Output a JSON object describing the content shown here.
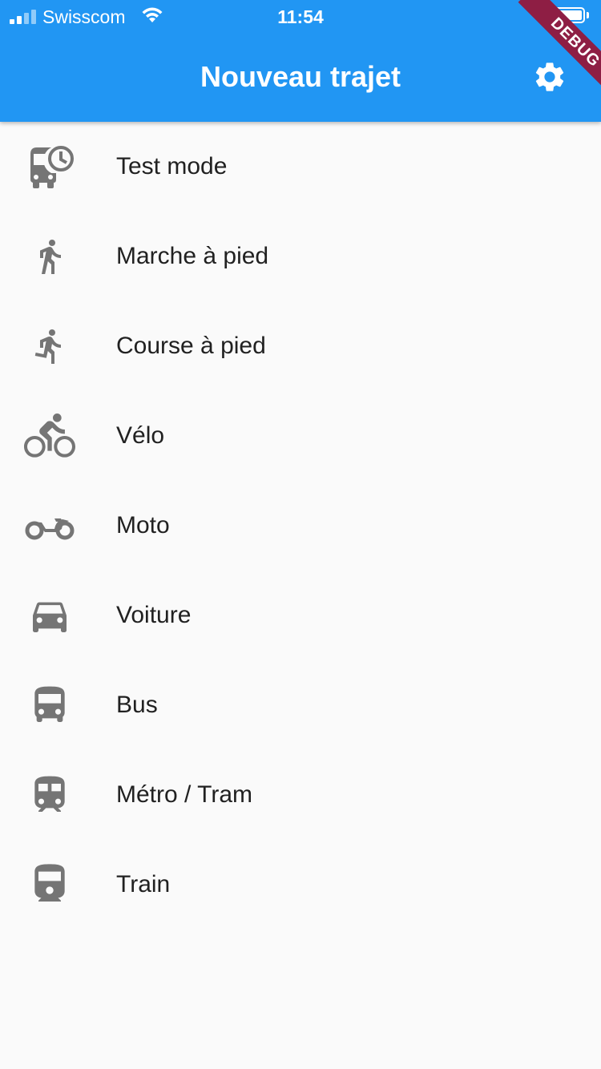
{
  "status_bar": {
    "carrier": "Swisscom",
    "time": "11:54"
  },
  "app_bar": {
    "title": "Nouveau trajet",
    "action_icon": "settings-icon",
    "debug_banner": "DEBUG"
  },
  "colors": {
    "app_bar": "#2196f3",
    "background": "#fafafa",
    "icon": "#757575",
    "text": "#212121",
    "debug_ribbon": "#8e1e44"
  },
  "modes": [
    {
      "label": "Test mode",
      "icon": "bus-clock-icon"
    },
    {
      "label": "Marche à pied",
      "icon": "walk-icon"
    },
    {
      "label": "Course à pied",
      "icon": "run-icon"
    },
    {
      "label": "Vélo",
      "icon": "bike-icon"
    },
    {
      "label": "Moto",
      "icon": "motorcycle-icon"
    },
    {
      "label": "Voiture",
      "icon": "car-icon"
    },
    {
      "label": "Bus",
      "icon": "bus-icon"
    },
    {
      "label": "Métro / Tram",
      "icon": "subway-icon"
    },
    {
      "label": "Train",
      "icon": "train-icon"
    }
  ]
}
